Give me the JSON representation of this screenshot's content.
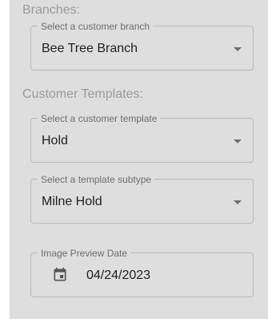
{
  "branches": {
    "section_title": "Branches:",
    "branch_select": {
      "label": "Select a customer branch",
      "value": "Bee Tree Branch"
    }
  },
  "templates": {
    "section_title": "Customer Templates:",
    "template_select": {
      "label": "Select a customer template",
      "value": "Hold"
    },
    "subtype_select": {
      "label": "Select a template subtype",
      "value": "Milne Hold"
    }
  },
  "preview": {
    "label": "Image Preview Date",
    "value": "04/24/2023",
    "icon": "calendar-icon"
  }
}
